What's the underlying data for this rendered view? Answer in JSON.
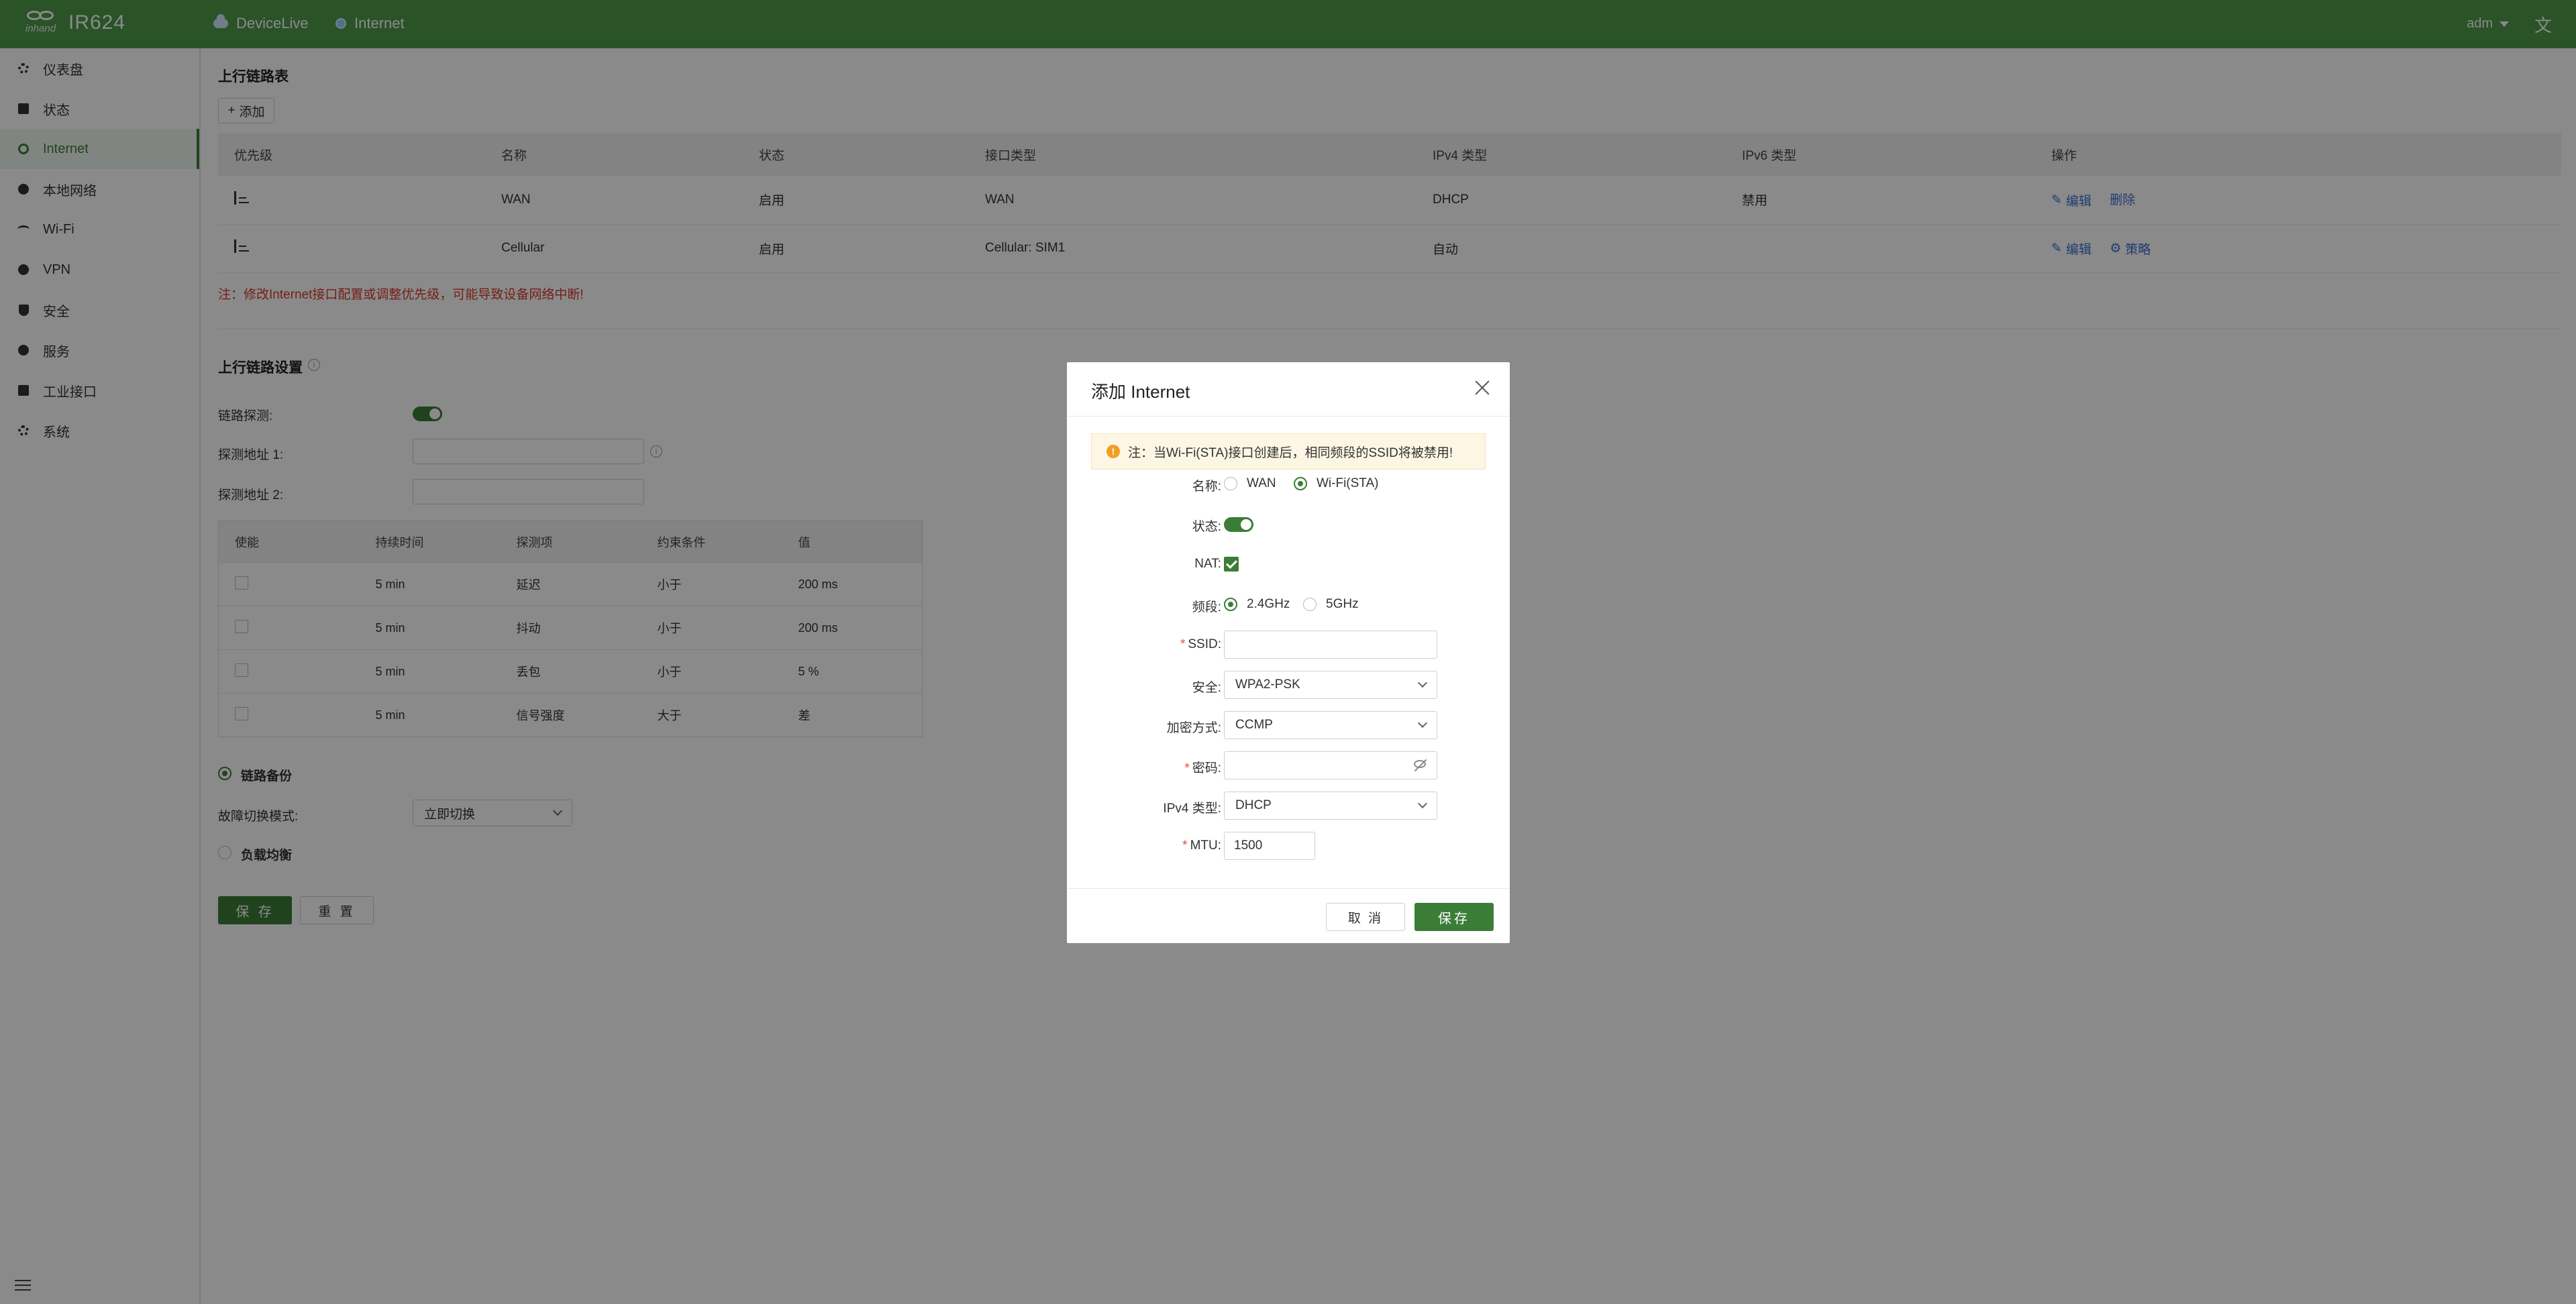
{
  "colors": {
    "primary": "#3b7d36",
    "topbar": "#4f9a4b",
    "warning": "#d9392e",
    "link": "#3a6fd0"
  },
  "topbar": {
    "brand_small": "inhand",
    "model": "IR624",
    "tabs": [
      "DeviceLive",
      "Internet"
    ],
    "user": "adm",
    "lang_icon": "文"
  },
  "sidebar": {
    "items": [
      {
        "label": "仪表盘",
        "icon": "dashboard-icon"
      },
      {
        "label": "状态",
        "icon": "status-icon"
      },
      {
        "label": "Internet",
        "icon": "globe-icon",
        "active": true
      },
      {
        "label": "本地网络",
        "icon": "lan-icon"
      },
      {
        "label": "Wi-Fi",
        "icon": "wifi-icon"
      },
      {
        "label": "VPN",
        "icon": "vpn-icon"
      },
      {
        "label": "安全",
        "icon": "shield-icon"
      },
      {
        "label": "服务",
        "icon": "service-icon"
      },
      {
        "label": "工业接口",
        "icon": "industrial-icon"
      },
      {
        "label": "系统",
        "icon": "gear-icon"
      }
    ]
  },
  "uplink_table": {
    "title": "上行链路表",
    "add_label": "添加",
    "headers": [
      "优先级",
      "名称",
      "状态",
      "接口类型",
      "IPv4 类型",
      "IPv6 类型",
      "操作"
    ],
    "rows": [
      {
        "name": "WAN",
        "status": "启用",
        "iface": "WAN",
        "ipv4": "DHCP",
        "ipv6": "禁用",
        "action1": "编辑",
        "action2": "删除"
      },
      {
        "name": "Cellular",
        "status": "启用",
        "iface": "Cellular: SIM1",
        "ipv4": "自动",
        "ipv6": "",
        "action1": "编辑",
        "action2": "策略"
      }
    ],
    "note": "注：修改Internet接口配置或调整优先级，可能导致设备网络中断!"
  },
  "uplink_settings": {
    "title": "上行链路设置",
    "detect_label": "链路探测:",
    "addr1_label": "探测地址 1:",
    "addr2_label": "探测地址 2:",
    "probe_headers": [
      "使能",
      "持续时间",
      "探测项",
      "约束条件",
      "值"
    ],
    "probe_rows": [
      {
        "duration": "5 min",
        "item": "延迟",
        "cond": "小于",
        "value": "200 ms"
      },
      {
        "duration": "5 min",
        "item": "抖动",
        "cond": "小于",
        "value": "200 ms"
      },
      {
        "duration": "5 min",
        "item": "丢包",
        "cond": "小于",
        "value": "5 %"
      },
      {
        "duration": "5 min",
        "item": "信号强度",
        "cond": "大于",
        "value": "差"
      }
    ],
    "backup_label": "链路备份",
    "failover_label": "故障切换模式:",
    "failover_value": "立即切换",
    "balance_label": "负载均衡",
    "save_label": "保 存",
    "reset_label": "重 置"
  },
  "modal": {
    "title": "添加 Internet",
    "alert": "注：当Wi-Fi(STA)接口创建后，相同频段的SSID将被禁用!",
    "name_label": "名称:",
    "name_options": [
      "WAN",
      "Wi-Fi(STA)"
    ],
    "status_label": "状态:",
    "nat_label": "NAT:",
    "band_label": "频段:",
    "band_options": [
      "2.4GHz",
      "5GHz"
    ],
    "ssid_label": "SSID:",
    "ssid_value": "",
    "security_label": "安全:",
    "security_value": "WPA2-PSK",
    "encrypt_label": "加密方式:",
    "encrypt_value": "CCMP",
    "password_label": "密码:",
    "password_value": "",
    "ipv4_label": "IPv4 类型:",
    "ipv4_value": "DHCP",
    "mtu_label": "MTU:",
    "mtu_value": "1500",
    "cancel_label": "取 消",
    "save_label": "保存"
  }
}
